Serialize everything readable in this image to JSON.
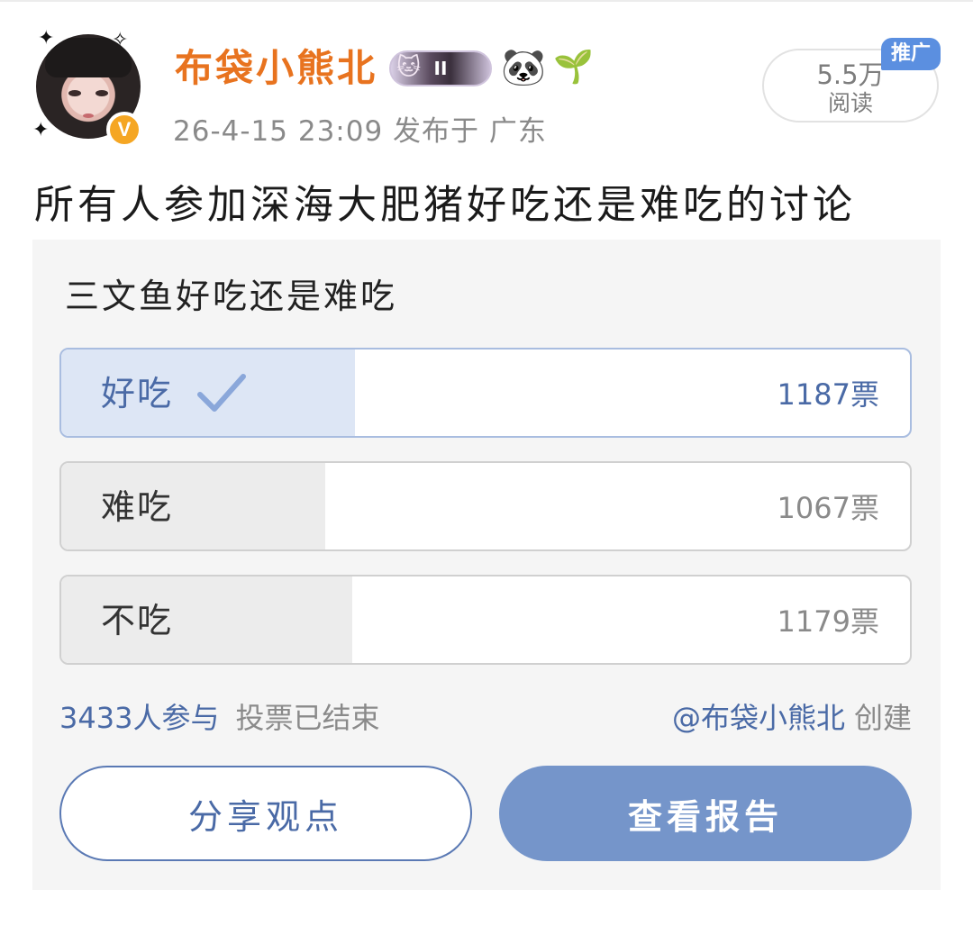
{
  "post": {
    "author": "布袋小熊北",
    "verified_badge": "V",
    "medal_label": "II",
    "meta": "26-4-15 23:09  发布于  广东",
    "read_count": "5.5万",
    "read_label": "阅读",
    "promo_tag": "推广",
    "title": "所有人参加深海大肥猪好吃还是难吃的讨论"
  },
  "poll": {
    "question": "三文鱼好吃还是难吃",
    "options": [
      {
        "label": "好吃",
        "votes": "1187票",
        "share": 0.346,
        "chosen": true
      },
      {
        "label": "难吃",
        "votes": "1067票",
        "share": 0.311,
        "chosen": false
      },
      {
        "label": "不吃",
        "votes": "1179票",
        "share": 0.343,
        "chosen": false
      }
    ],
    "participants": "3433人参与",
    "status": "投票已结束",
    "creator": "@布袋小熊北",
    "created_label": "创建",
    "share_button": "分享观点",
    "report_button": "查看报告"
  },
  "icons": {
    "avatar": "avatar-image",
    "medal": "fan-medal-icon",
    "panda": "panda-emoji-icon",
    "sprout": "sprout-emoji-icon",
    "check": "check-icon"
  },
  "colors": {
    "username": "#e8731f",
    "accent": "#4a6aa6",
    "report_button": "#7595ca",
    "chosen_fill": "#dde6f5",
    "promo": "#5b8fe0"
  }
}
